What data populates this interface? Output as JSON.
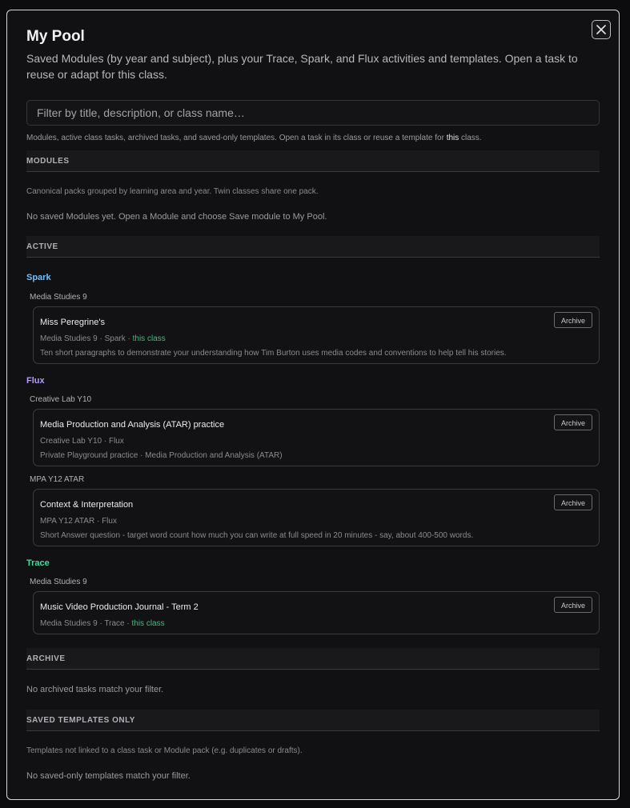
{
  "modal": {
    "title": "My Pool",
    "subtitle": "Saved Modules (by year and subject), plus your Trace, Spark, and Flux activities and templates. Open a task to reuse or adapt for this class.",
    "filter_placeholder": "Filter by title, description, or class name…",
    "help_pre": "Modules, active class tasks, archived tasks, and saved-only templates. Open a task in its class or reuse a template for ",
    "help_em": "this",
    "help_post": " class."
  },
  "sections": {
    "modules": {
      "heading": "MODULES",
      "note": "Canonical packs grouped by learning area and year. Twin classes share one pack.",
      "empty": "No saved Modules yet. Open a Module and choose Save module to My Pool."
    },
    "active": {
      "heading": "ACTIVE",
      "groups": [
        {
          "label": "Spark",
          "color": "#6cc0ff",
          "classes": [
            {
              "class_name": "Media Studies 9",
              "cards": [
                {
                  "title": "Miss Peregrine's",
                  "meta": "Media Studies 9 · Spark",
                  "this_class": " · this class",
                  "desc": "Ten short paragraphs to demonstrate your understanding how Tim Burton uses media codes and conventions to help tell his stories.",
                  "action": "Archive"
                }
              ]
            }
          ]
        },
        {
          "label": "Flux",
          "color": "#b49cff",
          "classes": [
            {
              "class_name": "Creative Lab Y10",
              "cards": [
                {
                  "title": "Media Production and Analysis (ATAR) practice",
                  "meta": "Creative Lab Y10 · Flux",
                  "desc": "Private Playground practice · Media Production and Analysis (ATAR)",
                  "action": "Archive"
                }
              ]
            },
            {
              "class_name": "MPA Y12 ATAR",
              "cards": [
                {
                  "title": "Context & Interpretation",
                  "meta": "MPA Y12 ATAR · Flux",
                  "desc": "Short Answer question - target word count how much you can write at full speed in 20 minutes - say, about 400-500 words.",
                  "action": "Archive"
                }
              ]
            }
          ]
        },
        {
          "label": "Trace",
          "color": "#4fd6a0",
          "classes": [
            {
              "class_name": "Media Studies 9",
              "cards": [
                {
                  "title": "Music Video Production Journal - Term 2",
                  "meta": "Media Studies 9 · Trace",
                  "this_class": " · this class",
                  "action": "Archive"
                }
              ]
            }
          ]
        }
      ]
    },
    "archive": {
      "heading": "ARCHIVE",
      "empty": "No archived tasks match your filter."
    },
    "templates": {
      "heading": "SAVED TEMPLATES ONLY",
      "note": "Templates not linked to a class task or Module pack (e.g. duplicates or drafts).",
      "empty": "No saved-only templates match your filter."
    }
  },
  "colors": {
    "this_class": "#3fbf7f",
    "spark": "#6cc0ff",
    "flux": "#b49cff",
    "trace": "#4fd6a0"
  },
  "icons": {
    "close": "close-icon"
  }
}
